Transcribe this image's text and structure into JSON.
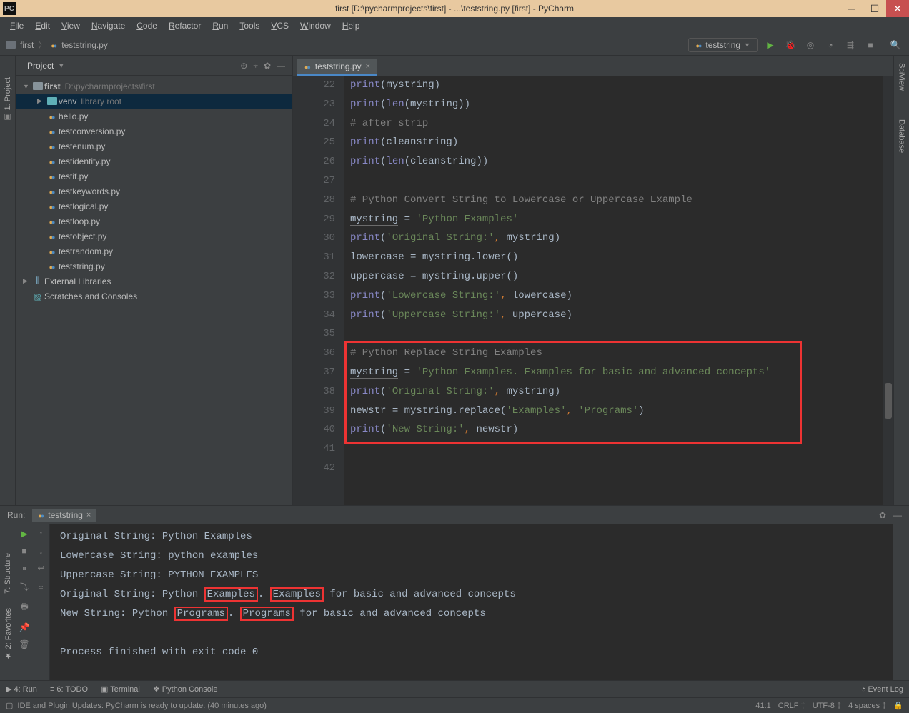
{
  "title": "first [D:\\pycharmprojects\\first] - ...\\teststring.py [first] - PyCharm",
  "appbadge": "PC",
  "menus": [
    "File",
    "Edit",
    "View",
    "Navigate",
    "Code",
    "Refactor",
    "Run",
    "Tools",
    "VCS",
    "Window",
    "Help"
  ],
  "breadcrumb": {
    "root": "first",
    "file": "teststring.py"
  },
  "runconfig": "teststring",
  "project_panel": {
    "title": "Project"
  },
  "tree": [
    {
      "indent": 0,
      "exp": "▼",
      "icon": "folder",
      "label": "first",
      "extra": "D:\\pycharmprojects\\first",
      "bold": true
    },
    {
      "indent": 1,
      "exp": "▶",
      "icon": "folder-cyan",
      "label": "venv",
      "extra": "library root",
      "selected": true
    },
    {
      "indent": 1,
      "exp": "",
      "icon": "py",
      "label": "hello.py"
    },
    {
      "indent": 1,
      "exp": "",
      "icon": "py",
      "label": "testconversion.py"
    },
    {
      "indent": 1,
      "exp": "",
      "icon": "py",
      "label": "testenum.py"
    },
    {
      "indent": 1,
      "exp": "",
      "icon": "py",
      "label": "testidentity.py"
    },
    {
      "indent": 1,
      "exp": "",
      "icon": "py",
      "label": "testif.py"
    },
    {
      "indent": 1,
      "exp": "",
      "icon": "py",
      "label": "testkeywords.py"
    },
    {
      "indent": 1,
      "exp": "",
      "icon": "py",
      "label": "testlogical.py"
    },
    {
      "indent": 1,
      "exp": "",
      "icon": "py",
      "label": "testloop.py"
    },
    {
      "indent": 1,
      "exp": "",
      "icon": "py",
      "label": "testobject.py"
    },
    {
      "indent": 1,
      "exp": "",
      "icon": "py",
      "label": "testrandom.py"
    },
    {
      "indent": 1,
      "exp": "",
      "icon": "py",
      "label": "teststring.py"
    },
    {
      "indent": 0,
      "exp": "▶",
      "icon": "lib",
      "label": "External Libraries"
    },
    {
      "indent": 0,
      "exp": "",
      "icon": "scratch",
      "label": "Scratches and Consoles"
    }
  ],
  "editor_tab": "teststring.py",
  "first_line": 22,
  "lines": [
    [
      [
        "fn",
        "print"
      ],
      [
        "p",
        "("
      ],
      [
        "var",
        "mystring"
      ],
      [
        "p",
        ")"
      ]
    ],
    [
      [
        "fn",
        "print"
      ],
      [
        "p",
        "("
      ],
      [
        "bi",
        "len"
      ],
      [
        "p",
        "("
      ],
      [
        "var",
        "mystring"
      ],
      [
        "p",
        "))"
      ]
    ],
    [
      [
        "cmt",
        "# after strip"
      ]
    ],
    [
      [
        "fn",
        "print"
      ],
      [
        "p",
        "("
      ],
      [
        "var",
        "cleanstring"
      ],
      [
        "p",
        ")"
      ]
    ],
    [
      [
        "fn",
        "print"
      ],
      [
        "p",
        "("
      ],
      [
        "bi",
        "len"
      ],
      [
        "p",
        "("
      ],
      [
        "var",
        "cleanstring"
      ],
      [
        "p",
        "))"
      ]
    ],
    [],
    [
      [
        "cmt",
        "# Python Convert String to Lowercase or Uppercase Example"
      ]
    ],
    [
      [
        "vun",
        "mystring"
      ],
      [
        "var",
        " = "
      ],
      [
        "str",
        "'Python Examples'"
      ]
    ],
    [
      [
        "fn",
        "print"
      ],
      [
        "p",
        "("
      ],
      [
        "str",
        "'Original String:'"
      ],
      [
        "com",
        ", "
      ],
      [
        "var",
        "mystring"
      ],
      [
        "p",
        ")"
      ]
    ],
    [
      [
        "var",
        "lowercase = mystring.lower()"
      ]
    ],
    [
      [
        "var",
        "uppercase = mystring.upper()"
      ]
    ],
    [
      [
        "fn",
        "print"
      ],
      [
        "p",
        "("
      ],
      [
        "str",
        "'Lowercase String:'"
      ],
      [
        "com",
        ", "
      ],
      [
        "var",
        "lowercase"
      ],
      [
        "p",
        ")"
      ]
    ],
    [
      [
        "fn",
        "print"
      ],
      [
        "p",
        "("
      ],
      [
        "str",
        "'Uppercase String:'"
      ],
      [
        "com",
        ", "
      ],
      [
        "var",
        "uppercase"
      ],
      [
        "p",
        ")"
      ]
    ],
    [],
    [
      [
        "cmt",
        "# Python Replace String Examples"
      ]
    ],
    [
      [
        "vun",
        "mystring"
      ],
      [
        "var",
        " = "
      ],
      [
        "str",
        "'Python Examples. Examples for basic and advanced concepts'"
      ]
    ],
    [
      [
        "fn",
        "print"
      ],
      [
        "p",
        "("
      ],
      [
        "str",
        "'Original String:'"
      ],
      [
        "com",
        ", "
      ],
      [
        "var",
        "mystring"
      ],
      [
        "p",
        ")"
      ]
    ],
    [
      [
        "vun",
        "newstr"
      ],
      [
        "var",
        " = mystring.replace("
      ],
      [
        "str",
        "'Examples'"
      ],
      [
        "com",
        ", "
      ],
      [
        "str",
        "'Programs'"
      ],
      [
        "p",
        ")"
      ]
    ],
    [
      [
        "fn",
        "print"
      ],
      [
        "p",
        "("
      ],
      [
        "str",
        "'New String:'"
      ],
      [
        "com",
        ", "
      ],
      [
        "var",
        "newstr"
      ],
      [
        "p",
        ")"
      ]
    ],
    [],
    []
  ],
  "run_tab": "teststring",
  "run_label": "Run:",
  "console_lines": [
    "Original String: Python Examples",
    "Lowercase String: python examples",
    "Uppercase String: PYTHON EXAMPLES",
    "Original String: Python |Examples|. |Examples| for basic and advanced concepts",
    "New String: Python |Programs|. |Programs| for basic and advanced concepts",
    "",
    "Process finished with exit code 0"
  ],
  "bottom": {
    "run": "4: Run",
    "todo": "6: TODO",
    "terminal": "Terminal",
    "pyconsole": "Python Console",
    "eventlog": "Event Log"
  },
  "status": {
    "msg": "IDE and Plugin Updates: PyCharm is ready to update. (40 minutes ago)",
    "pos": "41:1",
    "crlf": "CRLF",
    "enc": "UTF-8",
    "indent": "4 spaces"
  },
  "gutters": {
    "left_project": "1: Project",
    "left_structure": "7: Structure",
    "left_fav": "2: Favorites",
    "right_sci": "SciView",
    "right_db": "Database"
  }
}
